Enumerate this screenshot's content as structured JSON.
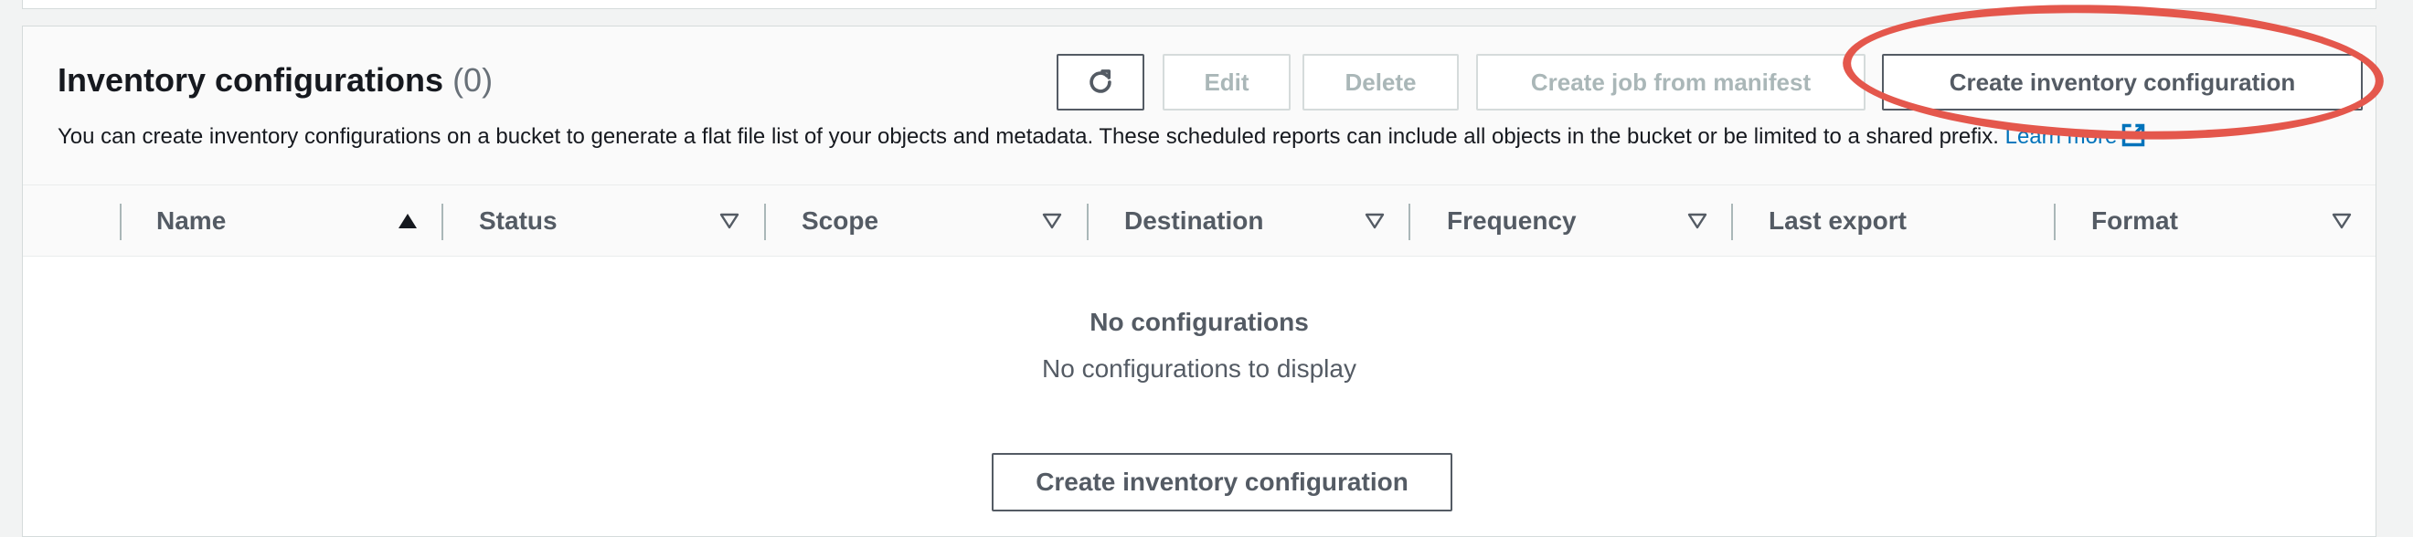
{
  "panel": {
    "title": "Inventory configurations",
    "count": "(0)",
    "description": "You can create inventory configurations on a bucket to generate a flat file list of your objects and metadata. These scheduled reports can include all objects in the bucket or be limited to a shared prefix.",
    "learn_more": "Learn more"
  },
  "toolbar": {
    "refresh_icon": "refresh-icon",
    "edit": "Edit",
    "delete": "Delete",
    "create_job": "Create job from manifest",
    "create_config": "Create inventory configuration"
  },
  "table": {
    "columns": [
      {
        "label": "Name",
        "sort": "ascending"
      },
      {
        "label": "Status",
        "sort": "none"
      },
      {
        "label": "Scope",
        "sort": "none"
      },
      {
        "label": "Destination",
        "sort": "none"
      },
      {
        "label": "Frequency",
        "sort": "none"
      },
      {
        "label": "Last export",
        "sort": "none"
      },
      {
        "label": "Format",
        "sort": "none"
      }
    ]
  },
  "empty_state": {
    "title": "No configurations",
    "subtitle": "No configurations to display",
    "button": "Create inventory configuration"
  },
  "colors": {
    "link": "#0073bb",
    "highlight": "#e4574c",
    "button_border": "#545b64",
    "disabled_text": "#aab7b8"
  }
}
